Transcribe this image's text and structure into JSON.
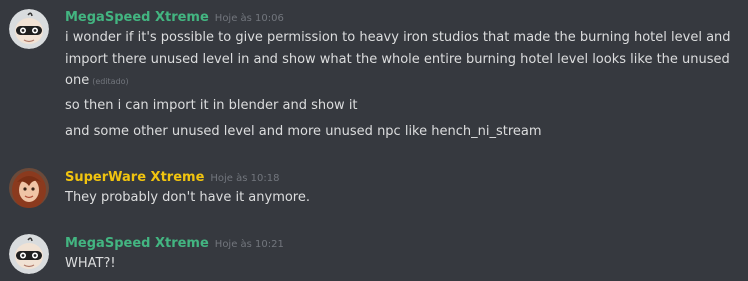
{
  "colors": {
    "background": "#36393f",
    "text": "#dcddde",
    "muted": "#72767d",
    "megaspeed_name": "#43b581",
    "superware_name": "#f1c40f"
  },
  "groups": [
    {
      "username": "MegaSpeed Xtreme",
      "timestamp": "Hoje às 10:06",
      "avatar_icon": "baby-face-avatar",
      "messages": [
        {
          "text": "i wonder if it's possible to give permission to heavy iron studios that made the burning hotel level and import there unused level in and show what the whole entire burning hotel level looks like the unused one",
          "edited": "(editado)"
        },
        {
          "text": "so then i can import it in blender and show it"
        },
        {
          "text": "and some other unused level and more unused npc like hench_ni_stream"
        }
      ]
    },
    {
      "username": "SuperWare Xtreme",
      "timestamp": "Hoje às 10:18",
      "avatar_icon": "red-haired-woman-avatar",
      "messages": [
        {
          "text": "They probably don't have it anymore."
        }
      ]
    },
    {
      "username": "MegaSpeed Xtreme",
      "timestamp": "Hoje às 10:21",
      "avatar_icon": "baby-face-avatar",
      "messages": [
        {
          "text": "WHAT?!"
        }
      ]
    }
  ]
}
